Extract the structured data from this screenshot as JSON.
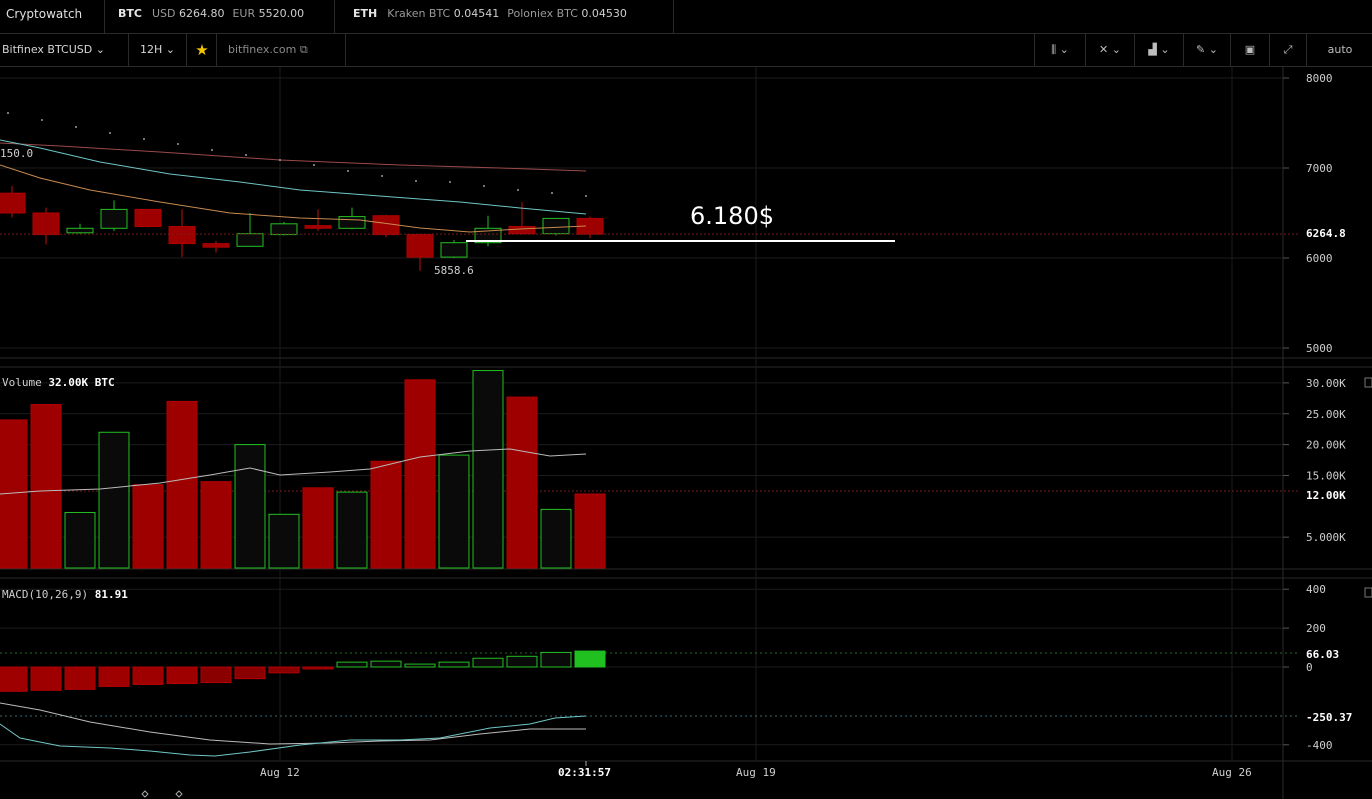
{
  "topbar": {
    "brand": "Cryptowatch",
    "btc": {
      "label": "BTC",
      "usd_label": "USD",
      "usd_value": "6264.80",
      "eur_label": "EUR",
      "eur_value": "5520.00"
    },
    "eth": {
      "label": "ETH",
      "kraken_label": "Kraken BTC",
      "kraken_value": "0.04541",
      "poloniex_label": "Poloniex BTC",
      "poloniex_value": "0.04530"
    }
  },
  "toolbar": {
    "market": "Bitfinex BTCUSD",
    "period": "12H",
    "link": "bitfinex.com",
    "scale": "auto",
    "icons": [
      "candles-icon",
      "crosshair-icon",
      "indicators-icon",
      "pencil-icon",
      "image-icon",
      "expand-icon"
    ]
  },
  "price_panel": {
    "last_price_label": "6264.8",
    "low_annotation": "5858.6",
    "left_edge_label": "150.0",
    "annotation_text": "6.180$",
    "y_ticks": [
      "8000",
      "7000",
      "6000",
      "5000"
    ]
  },
  "volume_panel": {
    "label": "Volume",
    "value": "32.00K BTC",
    "current_label": "12.00K",
    "y_ticks": [
      "30.00K",
      "25.00K",
      "20.00K",
      "15.00K",
      "5.000K"
    ]
  },
  "macd_panel": {
    "label": "MACD(10,26,9)",
    "value": "81.91",
    "current_hist_label": "66.03",
    "current_line_label": "-250.37",
    "y_ticks": [
      "400",
      "200",
      "0",
      "-400"
    ]
  },
  "time_axis": {
    "labels": [
      "Aug 12",
      "Aug 19",
      "Aug 26"
    ],
    "cursor_time": "02:31:57"
  },
  "colors": {
    "up": "#22c122",
    "down": "#b00000",
    "down_fill": "#9e0000",
    "grid": "#1c1c1c"
  },
  "chart_data": {
    "type": "candlestick",
    "candles": [
      {
        "o": 6720,
        "h": 6800,
        "l": 6450,
        "c": 6500
      },
      {
        "o": 6500,
        "h": 6560,
        "l": 6150,
        "c": 6260
      },
      {
        "o": 6280,
        "h": 6380,
        "l": 6270,
        "c": 6330
      },
      {
        "o": 6330,
        "h": 6640,
        "l": 6300,
        "c": 6540
      },
      {
        "o": 6540,
        "h": 6540,
        "l": 6340,
        "c": 6350
      },
      {
        "o": 6350,
        "h": 6540,
        "l": 6010,
        "c": 6160
      },
      {
        "o": 6160,
        "h": 6190,
        "l": 6060,
        "c": 6120
      },
      {
        "o": 6130,
        "h": 6500,
        "l": 6130,
        "c": 6270
      },
      {
        "o": 6260,
        "h": 6400,
        "l": 6250,
        "c": 6380
      },
      {
        "o": 6360,
        "h": 6540,
        "l": 6300,
        "c": 6330
      },
      {
        "o": 6330,
        "h": 6560,
        "l": 6320,
        "c": 6460
      },
      {
        "o": 6470,
        "h": 6480,
        "l": 6230,
        "c": 6260
      },
      {
        "o": 6260,
        "h": 6270,
        "l": 5858.6,
        "c": 6010
      },
      {
        "o": 6010,
        "h": 6200,
        "l": 6000,
        "c": 6170
      },
      {
        "o": 6170,
        "h": 6470,
        "l": 6130,
        "c": 6330
      },
      {
        "o": 6350,
        "h": 6620,
        "l": 6260,
        "c": 6270
      },
      {
        "o": 6270,
        "h": 6430,
        "l": 6250,
        "c": 6440
      },
      {
        "o": 6440,
        "h": 6460,
        "l": 6220,
        "c": 6264.8
      }
    ],
    "volume": [
      24000,
      26500,
      9000,
      22000,
      13500,
      27000,
      14000,
      20000,
      8700,
      13000,
      12300,
      17300,
      30500,
      18300,
      32000,
      27700,
      9500,
      12000
    ],
    "volume_up": [
      false,
      false,
      true,
      true,
      false,
      false,
      false,
      true,
      true,
      false,
      true,
      false,
      false,
      true,
      true,
      false,
      true,
      false
    ],
    "macd_hist": [
      -125,
      -120,
      -115,
      -100,
      -90,
      -85,
      -80,
      -60,
      -30,
      -10,
      25,
      30,
      15,
      25,
      45,
      55,
      75,
      81.91
    ],
    "y_range_price": [
      4900,
      8100
    ],
    "y_range_volume": [
      0,
      33000
    ],
    "y_range_macd": [
      -420,
      420
    ]
  }
}
